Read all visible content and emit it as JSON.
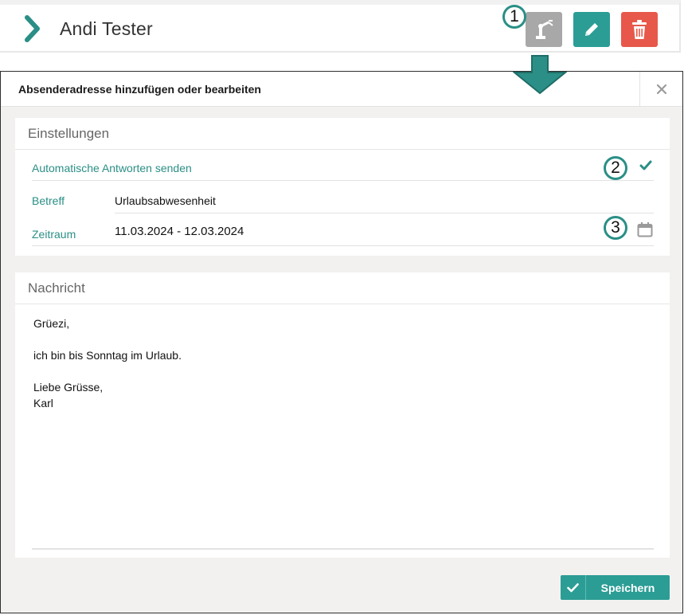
{
  "header": {
    "name": "Andi Tester",
    "buttons": [
      {
        "icon": "robot-arm-icon",
        "color": "#a8a8a8"
      },
      {
        "icon": "pencil-icon",
        "color": "#2b9d95"
      },
      {
        "icon": "trash-icon",
        "color": "#e7584a"
      }
    ]
  },
  "callouts": [
    "1",
    "2",
    "3"
  ],
  "modal": {
    "title": "Absenderadresse hinzufügen oder bearbeiten",
    "settings": {
      "title": "Einstellungen",
      "auto_reply_label": "Automatische Antworten senden",
      "auto_reply_checked": true,
      "subject_label": "Betreff",
      "subject_value": "Urlaubsabwesenheit",
      "period_label": "Zeitraum",
      "period_value": "11.03.2024 - 12.03.2024"
    },
    "message": {
      "title": "Nachricht",
      "lines": [
        "Grüezi,",
        "",
        "ich bin bis Sonntag im Urlaub.",
        "",
        "Liebe Grüsse,",
        "Karl"
      ]
    },
    "save_label": "Speichern"
  },
  "colors": {
    "accent": "#2b9d95",
    "danger": "#e7584a",
    "muted": "#a8a8a8"
  }
}
